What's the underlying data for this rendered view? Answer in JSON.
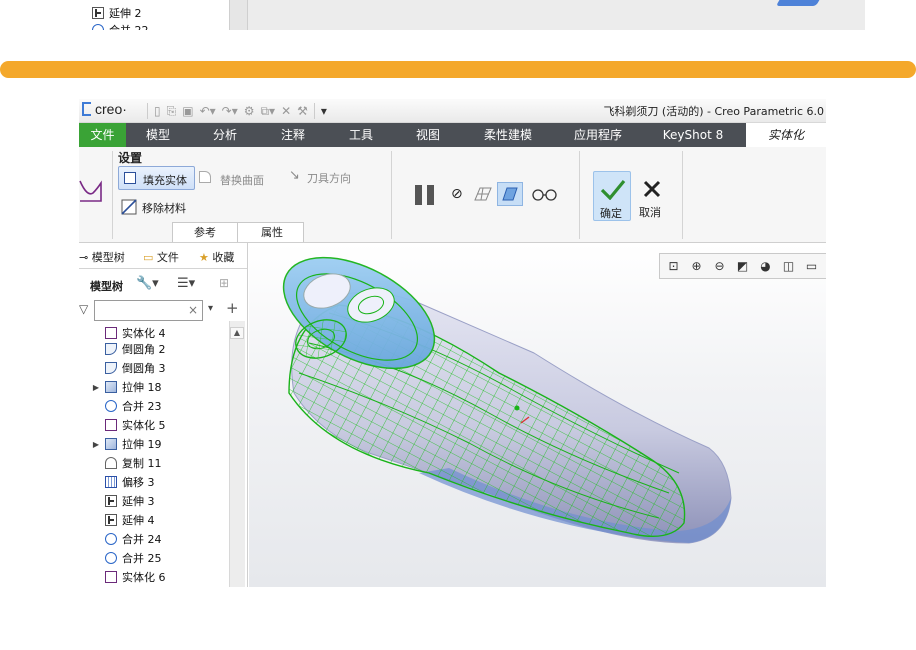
{
  "top_fragment": {
    "tree_items": [
      {
        "label": "延伸 2",
        "icon": "extend-icon"
      },
      {
        "label": "合并 22",
        "icon": "merge-icon"
      }
    ]
  },
  "window": {
    "logo": "creo",
    "title": "飞科剃须刀 (活动的) - Creo Parametric 6.0"
  },
  "tabs": [
    {
      "label": "文件"
    },
    {
      "label": "模型"
    },
    {
      "label": "分析"
    },
    {
      "label": "注释"
    },
    {
      "label": "工具"
    },
    {
      "label": "视图"
    },
    {
      "label": "柔性建模"
    },
    {
      "label": "应用程序"
    },
    {
      "label": "KeyShot 8"
    },
    {
      "label": "实体化"
    }
  ],
  "ribbon": {
    "group_label": "设置",
    "fill_solid": "填充实体",
    "replace_surface": "替换曲面",
    "tool_direction": "刀具方向",
    "remove_material": "移除材料",
    "sub_tabs": [
      "参考",
      "属性"
    ],
    "confirm": "确定",
    "cancel": "取消"
  },
  "tree": {
    "tabs": [
      "模型树",
      "文件",
      "收藏"
    ],
    "toolbar_label": "模型树",
    "search_value": "",
    "items": [
      {
        "label": "实体化 4",
        "icon": "solidify-icon",
        "expandable": false
      },
      {
        "label": "倒圆角 2",
        "icon": "round-icon",
        "expandable": false
      },
      {
        "label": "倒圆角 3",
        "icon": "round-icon",
        "expandable": false
      },
      {
        "label": "拉伸 18",
        "icon": "extrude-icon",
        "expandable": true
      },
      {
        "label": "合并 23",
        "icon": "merge-icon",
        "expandable": false
      },
      {
        "label": "实体化 5",
        "icon": "solidify-icon",
        "expandable": false
      },
      {
        "label": "拉伸 19",
        "icon": "extrude-icon",
        "expandable": true
      },
      {
        "label": "复制 11",
        "icon": "copy-icon",
        "expandable": false
      },
      {
        "label": "偏移 3",
        "icon": "offset-icon",
        "expandable": false
      },
      {
        "label": "延伸 3",
        "icon": "extend-icon",
        "expandable": false
      },
      {
        "label": "延伸 4",
        "icon": "extend-icon",
        "expandable": false
      },
      {
        "label": "合并 24",
        "icon": "merge-icon",
        "expandable": false
      },
      {
        "label": "合并 25",
        "icon": "merge-icon",
        "expandable": false
      },
      {
        "label": "实体化 6",
        "icon": "solidify-icon",
        "expandable": false
      }
    ]
  },
  "colors": {
    "divider": "#f4a82b",
    "file_tab": "#3aa336",
    "tab_bar": "#4b4f55",
    "mesh": "#1fbf1f",
    "model_body": "#c9cbe0",
    "model_head": "#8ec4ee"
  }
}
